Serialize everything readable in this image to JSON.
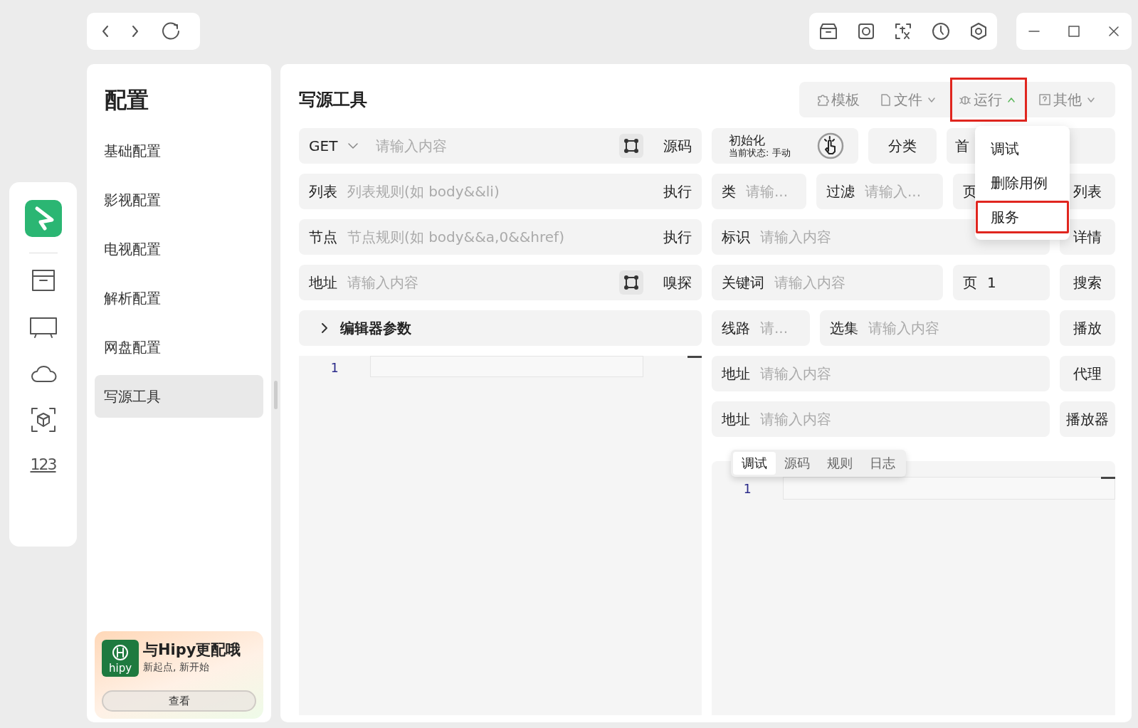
{
  "rail": {
    "numbers_label": "123"
  },
  "sidebar": {
    "title": "配置",
    "items": [
      {
        "label": "基础配置",
        "selected": false
      },
      {
        "label": "影视配置",
        "selected": false
      },
      {
        "label": "电视配置",
        "selected": false
      },
      {
        "label": "解析配置",
        "selected": false
      },
      {
        "label": "网盘配置",
        "selected": false
      },
      {
        "label": "写源工具",
        "selected": true
      }
    ]
  },
  "promo": {
    "logo": "hipy",
    "title": "与Hipy更配哦",
    "subtitle": "新起点, 新开始",
    "button": "查看"
  },
  "main": {
    "title": "写源工具",
    "toolbar": [
      {
        "label": "模板",
        "kind": "button",
        "highlighted": false
      },
      {
        "label": "文件",
        "kind": "dropdown",
        "expanded": false,
        "highlighted": false
      },
      {
        "label": "运行",
        "kind": "dropdown",
        "expanded": true,
        "highlighted": true
      },
      {
        "label": "其他",
        "kind": "dropdown",
        "expanded": false,
        "highlighted": false
      }
    ],
    "menu": [
      {
        "label": "调试",
        "highlighted": false
      },
      {
        "label": "删除用例",
        "highlighted": false
      },
      {
        "label": "服务",
        "highlighted": true
      }
    ],
    "request": {
      "method": "GET",
      "placeholder": "请输入内容",
      "button": "源码"
    },
    "rules": [
      {
        "label": "列表",
        "placeholder": "列表规则(如 body&&li)",
        "button": "执行",
        "kind": "plain"
      },
      {
        "label": "节点",
        "placeholder": "节点规则(如 body&&a,0&&href)",
        "button": "执行",
        "kind": "plain"
      },
      {
        "label": "地址",
        "placeholder": "请输入内容",
        "button": "嗅探",
        "kind": "picker"
      }
    ],
    "params": {
      "label": "编辑器参数",
      "expanded": false
    },
    "editor": {
      "line_numbers": [
        "1"
      ]
    },
    "actions": [
      {
        "cells": [
          {
            "kind": "init",
            "title": "初始化",
            "status": "当前状态: 手动"
          },
          {
            "kind": "button",
            "label": "分类"
          },
          {
            "kind": "button",
            "label": "首"
          }
        ]
      },
      {
        "cells": [
          {
            "kind": "field",
            "label": "类",
            "placeholder": "请输..."
          },
          {
            "kind": "field",
            "label": "过滤",
            "placeholder": "请输入..."
          },
          {
            "kind": "field",
            "label": "页"
          },
          {
            "kind": "button",
            "label": "列表"
          }
        ]
      },
      {
        "cells": [
          {
            "kind": "field",
            "label": "标识",
            "placeholder": "请输入内容"
          },
          {
            "kind": "button",
            "label": "详情"
          }
        ]
      },
      {
        "cells": [
          {
            "kind": "field",
            "label": "关键词",
            "placeholder": "请输入内容"
          },
          {
            "kind": "field",
            "label": "页",
            "value": "1"
          },
          {
            "kind": "button",
            "label": "搜索"
          }
        ]
      },
      {
        "cells": [
          {
            "kind": "field",
            "label": "线路",
            "placeholder": "请..."
          },
          {
            "kind": "field",
            "label": "选集",
            "placeholder": "请输入内容"
          },
          {
            "kind": "button",
            "label": "播放"
          }
        ]
      },
      {
        "cells": [
          {
            "kind": "field",
            "label": "地址",
            "placeholder": "请输入内容"
          },
          {
            "kind": "button",
            "label": "代理"
          }
        ]
      },
      {
        "cells": [
          {
            "kind": "field",
            "label": "地址",
            "placeholder": "请输入内容"
          },
          {
            "kind": "button",
            "label": "播放器"
          }
        ]
      }
    ],
    "output": {
      "tabs": [
        {
          "label": "调试",
          "selected": true
        },
        {
          "label": "源码",
          "selected": false
        },
        {
          "label": "规则",
          "selected": false
        },
        {
          "label": "日志",
          "selected": false
        }
      ],
      "line_numbers": [
        "1"
      ]
    }
  }
}
